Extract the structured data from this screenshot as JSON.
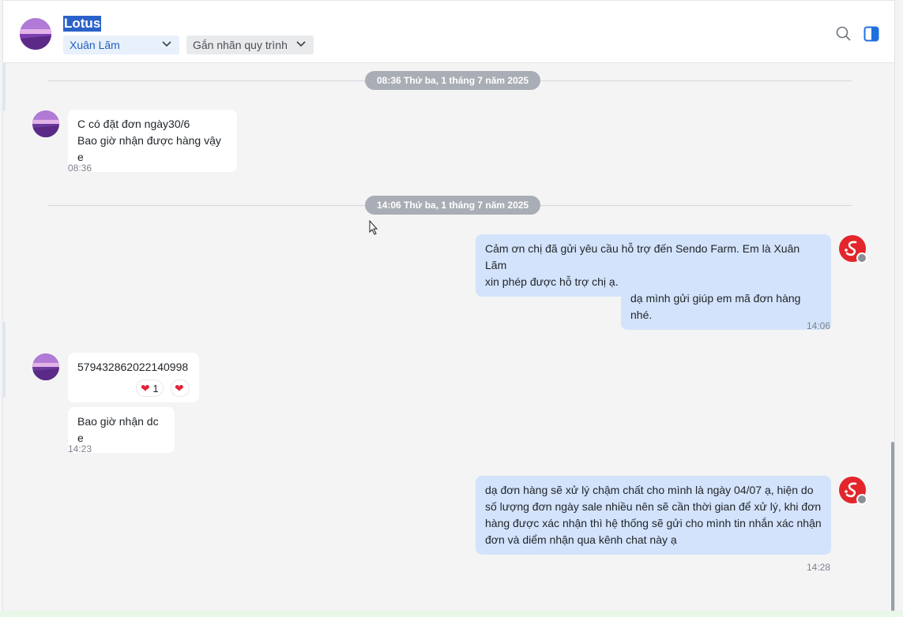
{
  "header": {
    "title": "Lotus",
    "assignee": "Xuân Lãm",
    "tag_label": "Gắn nhãn quy trình"
  },
  "separators": [
    {
      "label": "08:36 Thứ ba, 1 tháng 7 năm 2025"
    },
    {
      "label": "14:06 Thứ ba, 1 tháng 7 năm 2025"
    }
  ],
  "messages": {
    "m1_line1": "C có đặt đơn ngày30/6",
    "m1_line2": "Bao giờ nhận được hàng  vậy e",
    "m1_time": "08:36",
    "a1_line1": "Cảm ơn chị đã gửi yêu cầu hỗ trợ đến Sendo Farm. Em là Xuân Lãm",
    "a1_line2": "xin phép được hỗ trợ chị ạ.",
    "a2": "dạ mình gửi giúp em mã đơn hàng nhé.",
    "a_time": "14:06",
    "m2": "579432862022140998",
    "reaction_count": "1",
    "m3": "Bao giờ nhận dc e",
    "m_time2": "14:23",
    "a3_line1": "dạ đơn hàng sẽ xử lý chậm chất cho mình là ngày 04/07 ạ, hiện do",
    "a3_line2": "số lượng đơn ngày sale nhiều nên sẽ cần thời gian để xử lý, khi đơn",
    "a3_line3": "hàng được xác nhận thì hệ thống sẽ gửi cho mình tin nhắn xác nhận",
    "a3_line4": "đơn và diểm nhận qua kênh chat này ạ",
    "a_time2": "14:28"
  },
  "icons": {
    "search": "search-icon",
    "panel": "side-panel-icon",
    "heart": "heart-icon",
    "chevron": "chevron-down-icon"
  },
  "colors": {
    "accent": "#1f6fe0",
    "outgoing_bubble": "#d3e3fb",
    "agent_avatar": "#e3262b",
    "date_pill": "#a9adb5"
  }
}
